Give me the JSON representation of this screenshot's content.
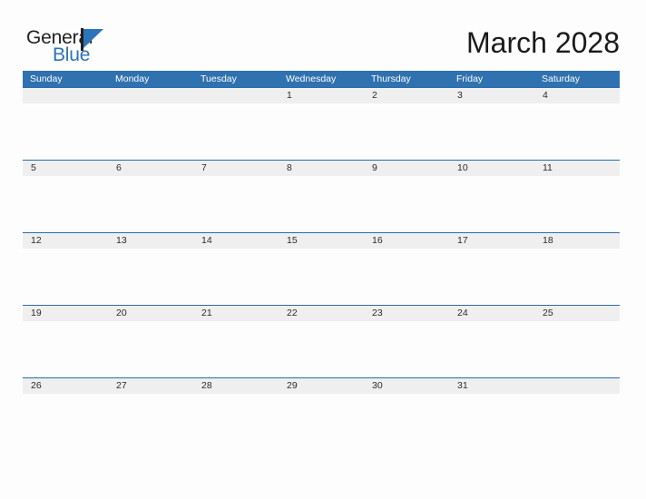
{
  "brand": {
    "name_part1": "General",
    "name_part2": "Blue",
    "flag_icon": "blue-flag-triangle-icon",
    "accent_color": "#2b74b8"
  },
  "title": "March 2028",
  "colors": {
    "header_blue": "#3071b0",
    "row_border_blue": "#2b6ca8",
    "day_band_gray": "#efefef",
    "page_background": "#fdfdfd",
    "title_text": "#1a1a1a",
    "day_text": "#2b2b2b",
    "weekday_text": "#ffffff"
  },
  "calendar": {
    "month": "March",
    "year": "2028",
    "weekday_headers": [
      "Sunday",
      "Monday",
      "Tuesday",
      "Wednesday",
      "Thursday",
      "Friday",
      "Saturday"
    ],
    "weeks": [
      {
        "days": [
          "",
          "",
          "",
          "1",
          "2",
          "3",
          "4"
        ]
      },
      {
        "days": [
          "5",
          "6",
          "7",
          "8",
          "9",
          "10",
          "11"
        ]
      },
      {
        "days": [
          "12",
          "13",
          "14",
          "15",
          "16",
          "17",
          "18"
        ]
      },
      {
        "days": [
          "19",
          "20",
          "21",
          "22",
          "23",
          "24",
          "25"
        ]
      },
      {
        "days": [
          "26",
          "27",
          "28",
          "29",
          "30",
          "31",
          ""
        ]
      }
    ]
  }
}
